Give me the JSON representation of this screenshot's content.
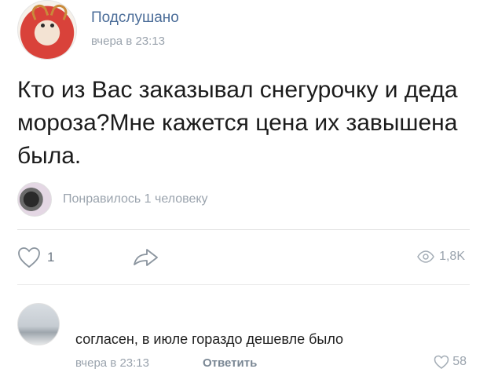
{
  "post": {
    "group_name": "Подслушано",
    "time": "вчера в 23:13",
    "text": "Кто из Вас заказывал снегурочку и деда мороза?Мне кажется цена их завышена была.",
    "likers_text": "Понравилось 1 человеку",
    "like_count": "1",
    "views": "1,8K",
    "like_icon": "heart-outline-icon",
    "share_icon": "share-arrow-icon",
    "views_icon": "eye-icon"
  },
  "comment": {
    "text": "согласен, в июле гораздо дешевле было",
    "time": "вчера в 23:13",
    "reply_label": "Ответить",
    "like_count": "58",
    "like_icon": "heart-outline-icon"
  },
  "colors": {
    "link_blue": "#4a6c98",
    "muted_gray": "#9aa3ad",
    "icon_gray": "#6d7884"
  }
}
